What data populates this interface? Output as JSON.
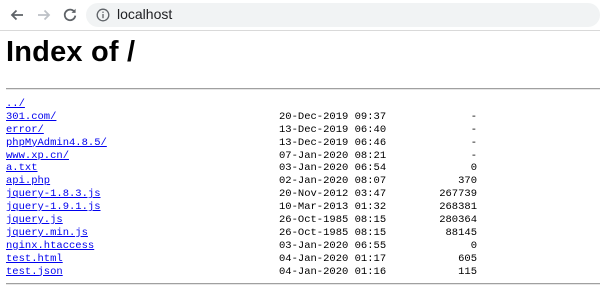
{
  "browser": {
    "url": "localhost"
  },
  "page": {
    "title": "Index of /",
    "parent_link": "../",
    "entries": [
      {
        "name": "301.com/",
        "date": "20-Dec-2019 09:37",
        "size": "-"
      },
      {
        "name": "error/",
        "date": "13-Dec-2019 06:40",
        "size": "-"
      },
      {
        "name": "phpMyAdmin4.8.5/",
        "date": "13-Dec-2019 06:46",
        "size": "-"
      },
      {
        "name": "www.xp.cn/",
        "date": "07-Jan-2020 08:21",
        "size": "-"
      },
      {
        "name": "a.txt",
        "date": "03-Jan-2020 06:54",
        "size": "0"
      },
      {
        "name": "api.php",
        "date": "02-Jan-2020 08:07",
        "size": "370"
      },
      {
        "name": "jquery-1.8.3.js",
        "date": "20-Nov-2012 03:47",
        "size": "267739"
      },
      {
        "name": "jquery-1.9.1.js",
        "date": "10-Mar-2013 01:32",
        "size": "268381"
      },
      {
        "name": "jquery.js",
        "date": "26-Oct-1985 08:15",
        "size": "280364"
      },
      {
        "name": "jquery.min.js",
        "date": "26-Oct-1985 08:15",
        "size": "88145"
      },
      {
        "name": "nginx.htaccess",
        "date": "03-Jan-2020 06:55",
        "size": "0"
      },
      {
        "name": "test.html",
        "date": "04-Jan-2020 01:17",
        "size": "605"
      },
      {
        "name": "test.json",
        "date": "04-Jan-2020 01:16",
        "size": "115"
      }
    ]
  },
  "colors": {
    "link": "#0000ee",
    "omnibox_bg": "#f1f3f4"
  }
}
